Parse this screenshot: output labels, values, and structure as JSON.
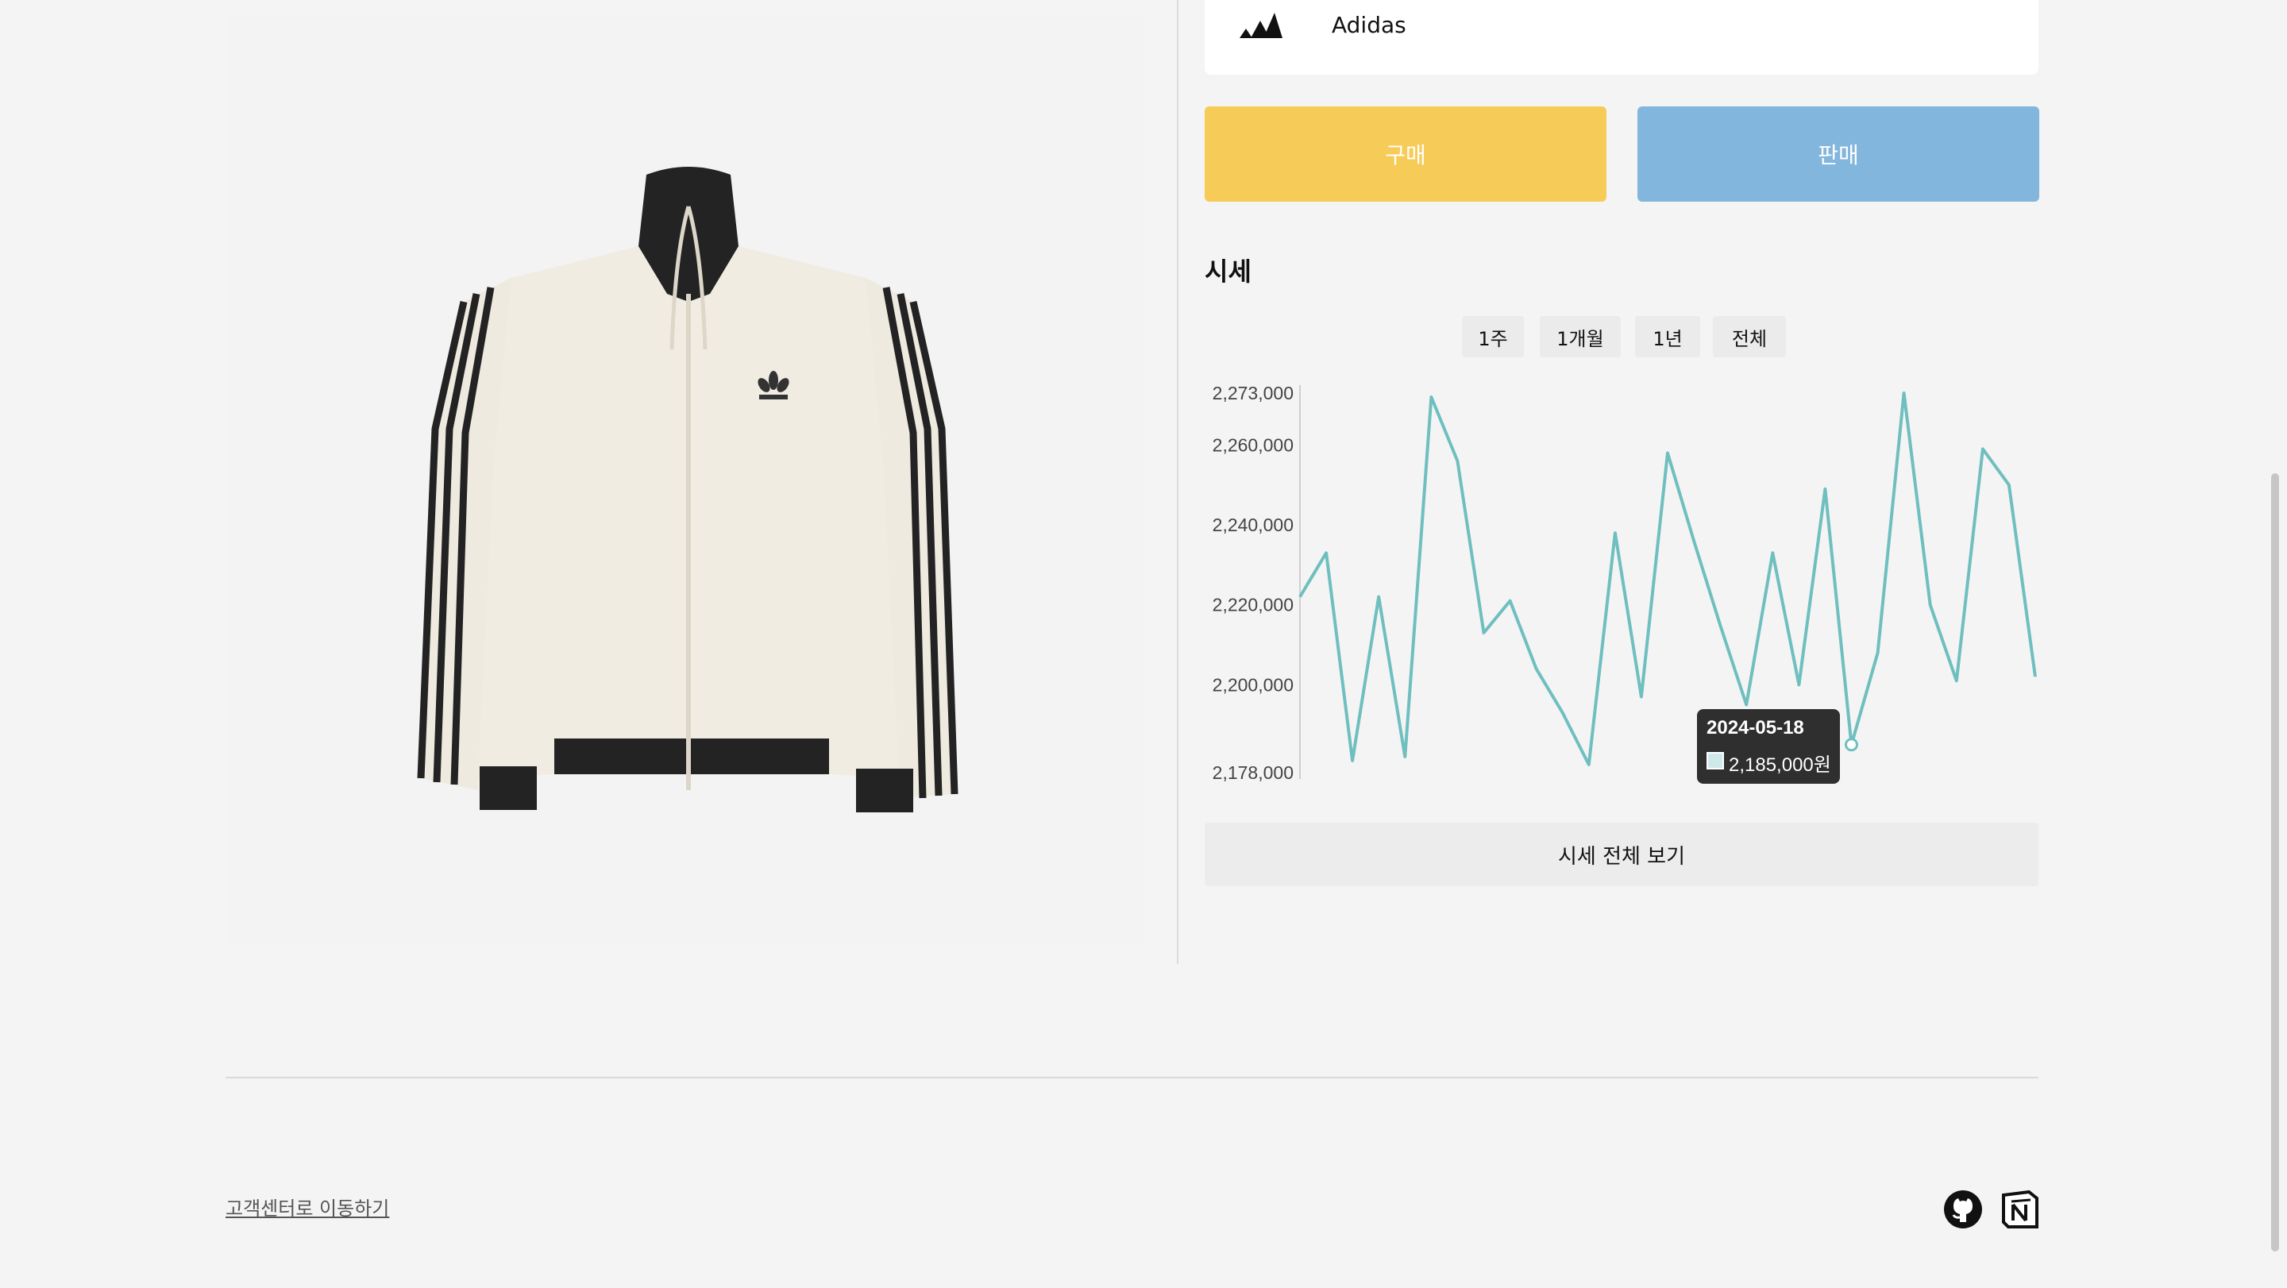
{
  "product": {
    "brand_name": "Adidas"
  },
  "actions": {
    "buy_label": "구매",
    "sell_label": "판매"
  },
  "price_section": {
    "title": "시세",
    "periods": [
      "1주",
      "1개월",
      "1년",
      "전체"
    ],
    "view_all_label": "시세 전체 보기"
  },
  "tooltip": {
    "date": "2024-05-18",
    "value": "2,185,000원"
  },
  "chart_data": {
    "type": "line",
    "title": "",
    "xlabel": "",
    "ylabel": "",
    "y_ticks": [
      2178000,
      2200000,
      2220000,
      2240000,
      2260000,
      2273000
    ],
    "y_tick_labels": [
      "2,178,000",
      "2,200,000",
      "2,220,000",
      "2,240,000",
      "2,260,000",
      "2,273,000"
    ],
    "ylim": [
      2178000,
      2273000
    ],
    "grid": false,
    "line_color": "#6fbfbf",
    "values": [
      2222000,
      2233000,
      2181000,
      2222000,
      2182000,
      2272000,
      2256000,
      2213000,
      2221000,
      2204000,
      2193000,
      2180000,
      2238000,
      2197000,
      2258000,
      2236000,
      2215000,
      2195000,
      2233000,
      2200000,
      2249000,
      2185000,
      2208000,
      2273000,
      2220000,
      2201000,
      2259000,
      2250000,
      2202000
    ],
    "highlighted_point": {
      "date": "2024-05-18",
      "value": 2185000
    }
  },
  "footer": {
    "support_link": "고객센터로 이동하기"
  },
  "colors": {
    "buy": "#f7cb58",
    "sell": "#83b6dc",
    "line": "#6fbfbf",
    "tooltip_bg": "#2f2f2f"
  },
  "icons": [
    "adidas-logo-icon",
    "github-icon",
    "notion-icon"
  ]
}
